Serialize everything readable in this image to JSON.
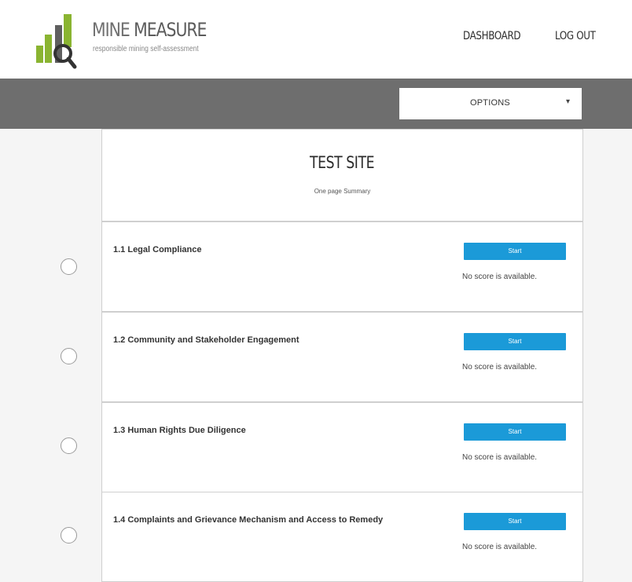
{
  "brand": {
    "title_first": "MINE",
    "title_rest": " MEASURE",
    "tagline": "responsible mining self-assessment",
    "colors": {
      "green": "#8ab431",
      "gray": "#5b5b5b"
    }
  },
  "nav": {
    "dashboard": "DASHBOARD",
    "logout": "LOG OUT"
  },
  "toolbar": {
    "options_label": "OPTIONS",
    "options_caret": "▾"
  },
  "summary": {
    "site_name": "TEST SITE",
    "subtitle": "One page Summary"
  },
  "sections": [
    {
      "title": "1.1 Legal Compliance",
      "button": "Start",
      "status": "No score is available."
    },
    {
      "title": "1.2 Community and Stakeholder Engagement",
      "button": "Start",
      "status": "No score is available."
    },
    {
      "title": "1.3 Human Rights Due Diligence",
      "button": "Start",
      "status": "No score is available."
    },
    {
      "title": "1.4 Complaints and Grievance Mechanism and Access to Remedy",
      "button": "Start",
      "status": "No score is available."
    }
  ],
  "colors": {
    "accent": "#1b9ad8",
    "toolbar": "#6e6e6e"
  }
}
